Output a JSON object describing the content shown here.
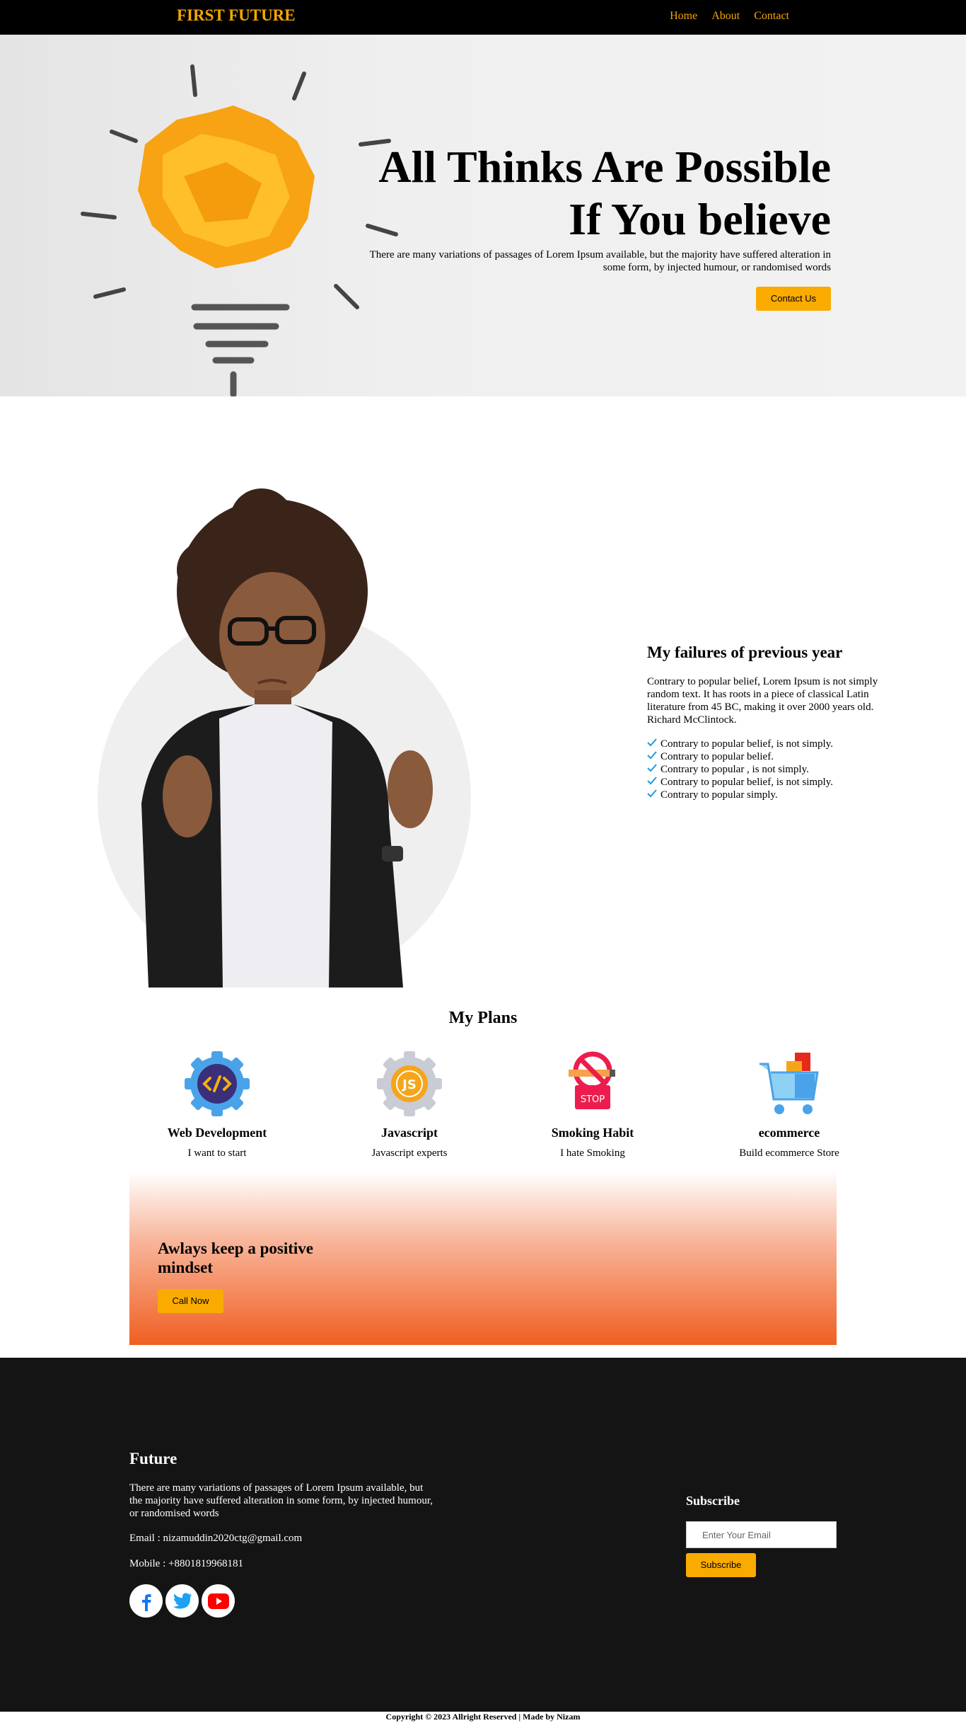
{
  "nav": {
    "brand": "FIRST FUTURE",
    "links": [
      "Home",
      "About",
      "Contact"
    ]
  },
  "hero": {
    "title": "All Thinks Are Possible If You believe",
    "subtitle": "There are many variations of passages of Lorem Ipsum available, but the majority have suffered alteration in some form, by injected humour, or randomised words",
    "button": "Contact Us"
  },
  "about": {
    "title": "My failures of previous year",
    "paragraph": "Contrary to popular belief, Lorem Ipsum is not simply random text. It has roots in a piece of classical Latin literature from 45 BC, making it over 2000 years old. Richard McClintock.",
    "checklist": [
      "Contrary to popular belief, is not simply.",
      "Contrary to popular belief.",
      "Contrary to popular , is not simply.",
      "Contrary to popular belief, is not simply.",
      "Contrary to popular simply."
    ]
  },
  "plans": {
    "title": "My Plans",
    "items": [
      {
        "name": "Web Development",
        "desc": "I want to start",
        "icon": "code-gear-icon"
      },
      {
        "name": "Javascript",
        "desc": "Javascript experts",
        "icon": "js-gear-icon"
      },
      {
        "name": "Smoking Habit",
        "desc": "I hate Smoking",
        "icon": "no-smoking-icon"
      },
      {
        "name": "ecommerce",
        "desc": "Build ecommerce Store",
        "icon": "shopping-cart-icon"
      }
    ]
  },
  "cta": {
    "title": "Awlays keep a positive mindset",
    "button": "Call Now"
  },
  "footer": {
    "title": "Future",
    "paragraph": "There are many variations of passages of Lorem Ipsum available, but the majority have suffered alteration in some form, by injected humour, or randomised words",
    "email": "Email : nizamuddin2020ctg@gmail.com",
    "mobile": "Mobile : +8801819968181",
    "socials": [
      "facebook-icon",
      "twitter-icon",
      "youtube-icon"
    ],
    "subscribe_title": "Subscribe",
    "subscribe_placeholder": "Enter Your Email",
    "subscribe_button": "Subscribe"
  },
  "copyright": "Copyright © 2023 Allright Reserved | Made by Nizam",
  "colors": {
    "accent": "#f9ab00",
    "brand": "#f5a700",
    "cta_bottom": "#f05f22",
    "footer_bg": "#141414"
  }
}
